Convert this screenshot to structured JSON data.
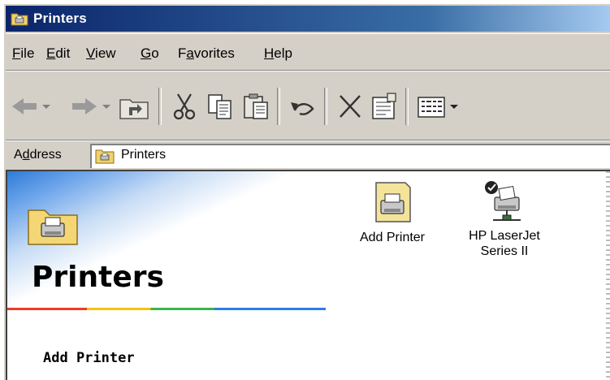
{
  "window": {
    "title": "Printers"
  },
  "menu": {
    "items": [
      {
        "key": "F",
        "rest": "ile"
      },
      {
        "key": "E",
        "rest": "dit"
      },
      {
        "key": "V",
        "rest": "iew"
      },
      {
        "key": "G",
        "rest": "o"
      },
      {
        "pre": "F",
        "key": "a",
        "rest": "vorites"
      },
      {
        "key": "H",
        "rest": "elp"
      }
    ]
  },
  "toolbar": {
    "icons": [
      "back-icon",
      "forward-icon",
      "up-folder-icon",
      "cut-icon",
      "copy-icon",
      "paste-icon",
      "undo-icon",
      "delete-icon",
      "properties-icon",
      "views-icon"
    ]
  },
  "address": {
    "label_pre": "A",
    "label_key": "d",
    "label_rest": "dress",
    "value": "Printers"
  },
  "panel": {
    "title": "Printers",
    "link": "Add Printer"
  },
  "files": [
    {
      "label": "Add Printer",
      "icon": "add-printer-icon"
    },
    {
      "label_line1": "HP LaserJet",
      "label_line2": "Series II",
      "icon": "networked-printer-icon"
    }
  ],
  "colors": {
    "titlebar_start": "#0a246a",
    "titlebar_end": "#a6caf0",
    "chrome": "#d4d0c8"
  }
}
